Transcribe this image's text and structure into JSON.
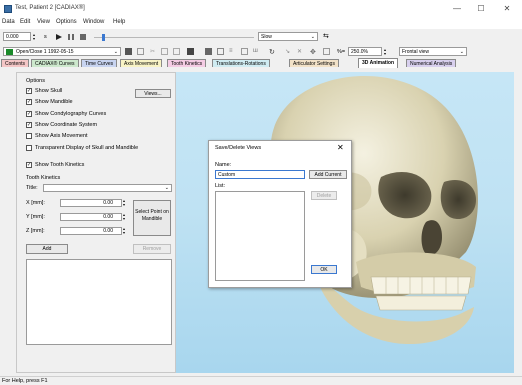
{
  "window": {
    "title": "Test, Patient 2 [CADIAX®]",
    "minimize": "—",
    "maximize": "☐",
    "close": "✕"
  },
  "menu": [
    "Data",
    "Edit",
    "View",
    "Options",
    "Window",
    "Help"
  ],
  "toolbar1": {
    "time_value": "0.000",
    "time_unit": "s",
    "speed_value": "Slow",
    "controls": [
      "play-icon",
      "pause-icon",
      "stop-icon"
    ]
  },
  "toolbar2": {
    "recording": "Open/Close 1 1992-05-15",
    "zoom": "250.0%",
    "view": "Frontal view",
    "zoom_label": "%="
  },
  "tabs": [
    {
      "label": "Contents",
      "color": "#f4c6c6"
    },
    {
      "label": "CADIAX® Curves",
      "color": "#cde8cd"
    },
    {
      "label": "Time Curves",
      "color": "#c8d4f0"
    },
    {
      "label": "Axis Movement",
      "color": "#f8f3c5"
    },
    {
      "label": "Tooth Kinetics",
      "color": "#f4cce4"
    },
    {
      "label": "Translations-Rotations",
      "color": "#d0ecf2"
    },
    {
      "label": "Articulator Settings",
      "color": "#f2e2c8"
    },
    {
      "label": "3D Animation",
      "color": "#ffffff"
    },
    {
      "label": "Numerical Analysis",
      "color": "#d8d0ee"
    }
  ],
  "options": {
    "heading": "Options",
    "views_button": "Views...",
    "items": [
      {
        "label": "Show Skull",
        "checked": true
      },
      {
        "label": "Show Mandible",
        "checked": true
      },
      {
        "label": "Show Condylography Curves",
        "checked": true
      },
      {
        "label": "Show Coordinate System",
        "checked": true
      },
      {
        "label": "Show Axis Movement",
        "checked": false
      },
      {
        "label": "Transparent Display of Skull and Mandible",
        "checked": false
      },
      {
        "label": "Show Tooth Kinetics",
        "checked": true
      }
    ]
  },
  "tooth_kinetics": {
    "heading": "Tooth Kinetics",
    "title_label": "Title:",
    "title_value": "",
    "x_label": "X [mm]:",
    "x_value": "0.00",
    "y_label": "Y [mm]:",
    "y_value": "0.00",
    "z_label": "Z [mm]:",
    "z_value": "0.00",
    "select_point": "Select Point on Mandible",
    "add": "Add",
    "remove": "Remove"
  },
  "dialog": {
    "title": "Save/Delete Views",
    "close": "✕",
    "name_label": "Name:",
    "name_value": "Custom",
    "add_current": "Add Current",
    "list_label": "List:",
    "delete": "Delete",
    "ok": "OK"
  },
  "status": "For Help, press F1"
}
